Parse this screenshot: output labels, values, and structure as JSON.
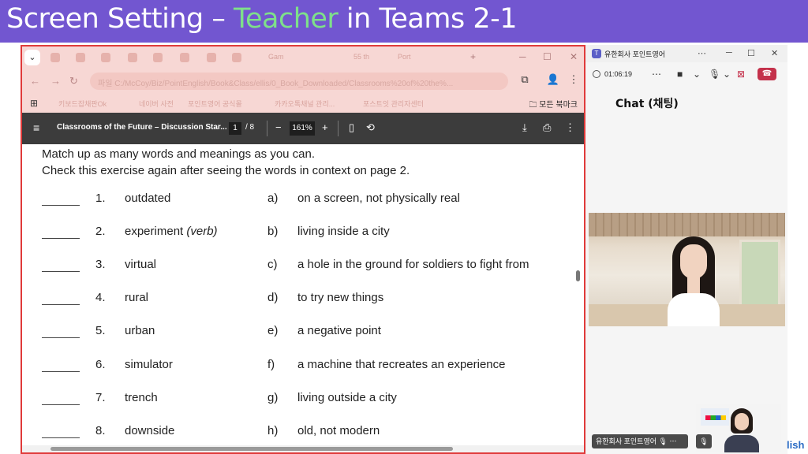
{
  "slide": {
    "title_part1": "Screen Setting – ",
    "title_accent": "Teacher",
    "title_part2": " in Teams 2-1",
    "accent_color": "#7ee08a",
    "banner_color": "#7256d0"
  },
  "browser": {
    "url": "C:/McCoy/Biz/PointEnglish/Book&Class/ellis/0_Book_Downloaded/Classrooms%20of%20the%...",
    "url_prefix": "파일",
    "bookmarks": [
      "키보드잡채판Ok",
      "네이버 사전",
      "포인트영어 공식몰",
      "카카오톡채널 관리...",
      "포스트잇 관리자센터"
    ],
    "all_bookmarks_label": "모든 북마크",
    "faded_tabs": [
      "Gam",
      "55 th",
      "Port"
    ]
  },
  "pdf": {
    "title": "Classrooms of the Future – Discussion Star...",
    "current_page": "1",
    "page_of": "/  8",
    "zoom": "161%"
  },
  "worksheet": {
    "instruction_1": "Match up as many words and meanings as you can.",
    "instruction_2": "Check this exercise again after seeing the words in context on page 2.",
    "items": [
      {
        "num": "1.",
        "word": "outdated",
        "note": "",
        "letter": "a)",
        "meaning": "on a screen, not physically real"
      },
      {
        "num": "2.",
        "word": "experiment ",
        "note": "(verb)",
        "letter": "b)",
        "meaning": "living inside a city"
      },
      {
        "num": "3.",
        "word": "virtual",
        "note": "",
        "letter": "c)",
        "meaning": "a hole in the ground for soldiers to fight from"
      },
      {
        "num": "4.",
        "word": "rural",
        "note": "",
        "letter": "d)",
        "meaning": "to try new things"
      },
      {
        "num": "5.",
        "word": "urban",
        "note": "",
        "letter": "e)",
        "meaning": "a negative point"
      },
      {
        "num": "6.",
        "word": "simulator",
        "note": "",
        "letter": "f)",
        "meaning": "a machine that recreates an experience"
      },
      {
        "num": "7.",
        "word": "trench",
        "note": "",
        "letter": "g)",
        "meaning": "living outside a city"
      },
      {
        "num": "8.",
        "word": "downside",
        "note": "",
        "letter": "h)",
        "meaning": "old, not modern"
      }
    ]
  },
  "teams": {
    "window_title": "유한회사 포인트영어",
    "call_time": "01:06:19",
    "chat_label": "Chat (채팅)",
    "participant_name": "유한회사 포인트영어",
    "leave_color": "#c4314b"
  },
  "footer": {
    "partial_text": "lish"
  }
}
